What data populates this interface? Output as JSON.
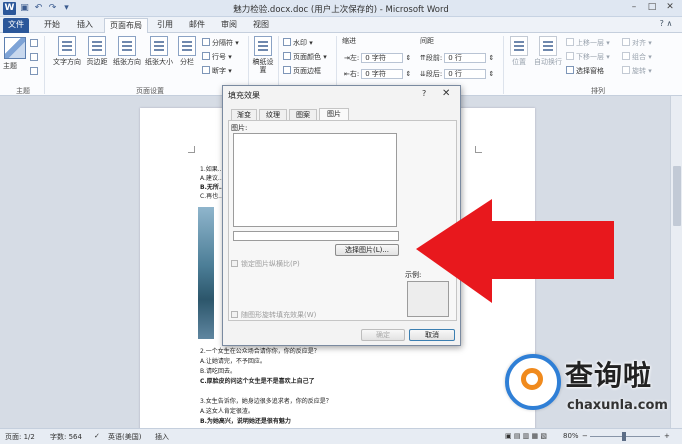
{
  "window": {
    "title": "魅力检验.docx.doc (用户上次保存的) - Microsoft Word",
    "quick_access": [
      "save-icon",
      "undo-icon",
      "redo-icon",
      "customize-icon"
    ],
    "controls": [
      "minimize",
      "maximize",
      "close"
    ]
  },
  "tabs": [
    {
      "label": "文件",
      "active": false
    },
    {
      "label": "开始",
      "active": false
    },
    {
      "label": "插入",
      "active": false
    },
    {
      "label": "页面布局",
      "active": true
    },
    {
      "label": "引用",
      "active": false
    },
    {
      "label": "邮件",
      "active": false
    },
    {
      "label": "审阅",
      "active": false
    },
    {
      "label": "视图",
      "active": false
    }
  ],
  "ribbon": {
    "groups": {
      "theme": "主题",
      "page_setup": "页面设置",
      "arrange": "排列"
    },
    "theme_btn": "主题",
    "text_direction": "文字方向",
    "margins": "页边距",
    "orientation": "纸张方向",
    "size": "纸张大小",
    "columns": "分栏",
    "breaks": "分隔符",
    "line_numbers": "行号",
    "hyphenation": "断字",
    "draft_settings": "稿纸设置",
    "watermark": "水印",
    "page_color": "页面颜色",
    "page_border": "页面边框",
    "indent_label": "缩进",
    "indent_left_label": "左:",
    "indent_left_value": "0 字符",
    "indent_right_label": "右:",
    "indent_right_value": "0 字符",
    "spacing_label": "间距",
    "spacing_before_label": "段前:",
    "spacing_before_value": "0 行",
    "spacing_after_label": "段后:",
    "spacing_after_value": "0 行",
    "position": "位置",
    "wrap_text": "自动换行",
    "bring_forward": "上移一层",
    "send_backward": "下移一层",
    "selection_pane": "选择窗格",
    "align": "对齐",
    "group": "组合",
    "rotate": "旋转"
  },
  "document": {
    "lines_top": [
      "1.如果...",
      "A.建议...",
      "B.无所...",
      "C.再也..."
    ],
    "lines_bottom": [
      "2.一个女生在公众场合请你你，你的反应是？",
      "A.让她请完，不予回应。",
      "B.请吃回去。",
      "C.厚脸皮的问这个女生是不是喜欢上自己了",
      "3.女生告诉你，她身边很多追求者，你的反应是？",
      "A.这女人肯定很渣。",
      "B.为她高兴，说明她还是很有魅力"
    ]
  },
  "dialog": {
    "title": "填充效果",
    "help": "?",
    "close": "✕",
    "tabs": [
      "渐变",
      "纹理",
      "图案",
      "图片"
    ],
    "active_tab": "图片",
    "picture_label": "图片:",
    "select_picture_button": "选择图片(L)...",
    "lock_aspect_label": "锁定图片纵横比(P)",
    "rotate_fill_label": "随图形旋转填充效果(W)",
    "sample_label": "示例:",
    "ok_button": "确定",
    "cancel_button": "取消"
  },
  "watermark": {
    "title": "查询啦",
    "url": "chaxunla.com"
  },
  "status_bar": {
    "page": "页面: 1/2",
    "word_count": "字数: 564",
    "language": "英语(美国)",
    "insert_mode": "插入",
    "zoom": "80%"
  },
  "colors": {
    "accent": "#2b579a",
    "arrow": "#e8181d",
    "watermark_ring": "#2f7fd6",
    "watermark_q": "#f08a1d"
  }
}
